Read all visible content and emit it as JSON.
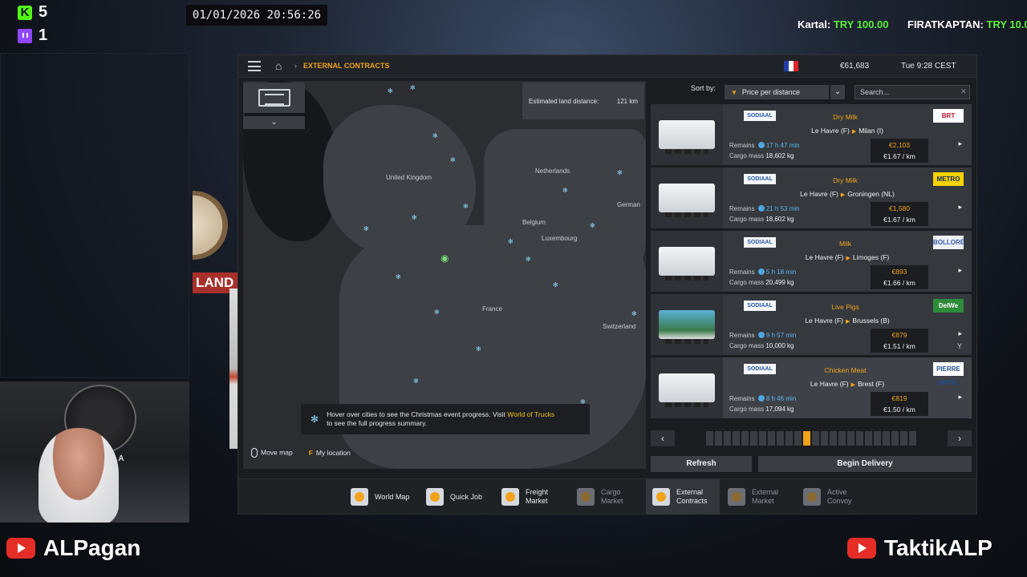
{
  "overlay": {
    "kick_count": "5",
    "twitch_count": "1",
    "datetime": "01/01/2026 20:56:26",
    "donations": [
      {
        "name": "Kartal:",
        "amount": "TRY 100.00"
      },
      {
        "name": "FIRATKAPTAN:",
        "amount": "TRY 10.0"
      }
    ],
    "channel_left": "ALPagan",
    "channel_right": "TaktikALP",
    "webcam_poster": "VALHALLA",
    "deco_sign": "LAND"
  },
  "game": {
    "topbar": {
      "breadcrumb": "EXTERNAL CONTRACTS",
      "money": "€61,683",
      "clock": "Tue 9:28 CEST"
    },
    "map": {
      "estimated_label": "Estimated land distance:",
      "estimated_value": "121 km",
      "labels": [
        "United Kingdom",
        "Netherlands",
        "Belgium",
        "Luxembourg",
        "German",
        "France",
        "Switzerland"
      ],
      "hint_line1_pre": "Hover over cities to see the Christmas event progress. Visit ",
      "hint_link": "World of Trucks",
      "hint_line2": "to see the full progress summary.",
      "footer_move": "Move map",
      "footer_key": "F",
      "footer_location": "My location",
      "dropdown_glyph": "⌄"
    },
    "sort": {
      "label": "Sort by:",
      "selected": "Price per distance",
      "search_placeholder": "Search..."
    },
    "contracts": [
      {
        "company": "SODIAAL",
        "cargo": "Dry Milk",
        "client": "BRT",
        "client_bg": "#ffffff",
        "client_fg": "#c8102e",
        "origin": "Le Havre (F)",
        "dest": "Milan (I)",
        "remains": "17 h 47 min",
        "mass": "18,602 kg",
        "price": "€2,103",
        "perkm": "€1.67 / km",
        "trailer": "plain"
      },
      {
        "company": "SODIAAL",
        "cargo": "Dry Milk",
        "client": "METRO",
        "client_bg": "#f6d200",
        "client_fg": "#0b2a6b",
        "origin": "Le Havre (F)",
        "dest": "Groningen (NL)",
        "remains": "21 h 53 min",
        "mass": "18,602 kg",
        "price": "€1,580",
        "perkm": "€1.67 / km",
        "trailer": "plain"
      },
      {
        "company": "SODIAAL",
        "cargo": "Milk",
        "client": "BOLLORÉ",
        "client_bg": "#f0f2f7",
        "client_fg": "#3559a8",
        "origin": "Le Havre (F)",
        "dest": "Limoges (F)",
        "remains": "5 h 18 min",
        "mass": "20,499 kg",
        "price": "€893",
        "perkm": "€1.66 / km",
        "trailer": "plain"
      },
      {
        "company": "SODIAAL",
        "cargo": "Live Pigs",
        "client": "DelWe",
        "client_bg": "#2e8b3a",
        "client_fg": "#ffffff",
        "origin": "Le Havre (F)",
        "dest": "Brussels (B)",
        "remains": "9 h 57 min",
        "mass": "10,000 kg",
        "price": "€879",
        "perkm": "€1.51 / km",
        "trailer": "pigs",
        "extra_icon": "Y"
      },
      {
        "company": "SODIAAL",
        "cargo": "Chicken Meat",
        "client": "PIERRE NATAL",
        "client_bg": "#ffffff",
        "client_fg": "#1d4f8f",
        "origin": "Le Havre (F)",
        "dest": "Brest (F)",
        "remains": "8 h 46 min",
        "mass": "17,094 kg",
        "price": "€819",
        "perkm": "€1.50 / km",
        "trailer": "plain"
      }
    ],
    "contract_labels": {
      "remains": "Remains",
      "mass": "Cargo mass",
      "go": "▸"
    },
    "pager": {
      "prev": "‹",
      "next": "›",
      "total_pages": 24,
      "current_page": 12
    },
    "buttons": {
      "refresh": "Refresh",
      "deliver": "Begin Delivery"
    },
    "nav": [
      {
        "line1": "World Map",
        "line2": "",
        "state": "normal"
      },
      {
        "line1": "Quick Job",
        "line2": "",
        "state": "normal"
      },
      {
        "line1": "Freight",
        "line2": "Market",
        "state": "normal"
      },
      {
        "line1": "Cargo",
        "line2": "Market",
        "state": "dim"
      },
      {
        "line1": "External",
        "line2": "Contracts",
        "state": "active"
      },
      {
        "line1": "External",
        "line2": "Market",
        "state": "dim"
      },
      {
        "line1": "Active",
        "line2": "Convoy",
        "state": "dim"
      }
    ]
  }
}
